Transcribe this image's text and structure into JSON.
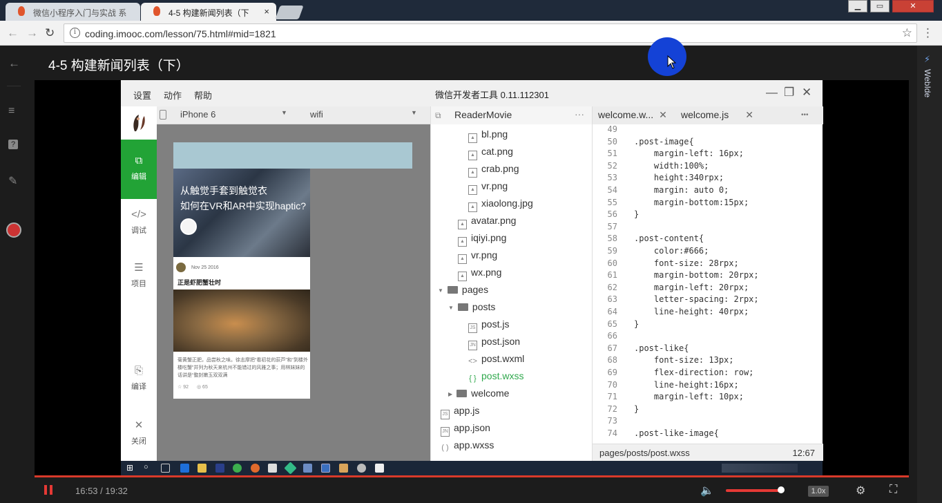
{
  "browser": {
    "tabs": [
      {
        "title": "微信小程序入门与实战 系"
      },
      {
        "title": "4-5 构建新闻列表（下",
        "close": "×"
      }
    ],
    "url": "coding.imooc.com/lesson/75.html#mid=1821",
    "window_controls": [
      "▁",
      "▭",
      "✕"
    ]
  },
  "lesson": {
    "title": "4-5 构建新闻列表（下）"
  },
  "right_panel": {
    "label": "WebIde"
  },
  "ide": {
    "menu": [
      "设置",
      "动作",
      "帮助"
    ],
    "title": "微信开发者工具 0.11.112301",
    "sidebar": [
      {
        "label": "编辑",
        "icon": "code-square-icon",
        "active": true
      },
      {
        "label": "调试",
        "icon": "code-icon"
      },
      {
        "label": "项目",
        "icon": "list-icon"
      },
      {
        "label": "编译",
        "icon": "compile-icon"
      },
      {
        "label": "关闭",
        "icon": "close-icon"
      }
    ],
    "simulator": {
      "device": "iPhone 6",
      "network": "wifi",
      "banner_title": "从触觉手套到触觉衣",
      "banner_subtitle": "如何在VR和AR中实现haptic?",
      "post_date": "Nov 25 2016",
      "post_title": "正是虾肥蟹壮时",
      "post_body": "菊黄蟹正肥，品尝秋之味。徐志摩把“看初花的荻芦”和“到楼外楼吃蟹”并列为秋天来杭州不能错过的风雅之事；用林妹妹的话讲是“螯封嫩玉双双满",
      "post_stars": "92",
      "post_views": "65"
    },
    "tree": {
      "project": "ReaderMovie",
      "items": [
        "bl.png",
        "cat.png",
        "crab.png",
        "vr.png",
        "xiaolong.jpg",
        "avatar.png",
        "iqiyi.png",
        "vr.png",
        "wx.png",
        "pages",
        "posts",
        "post.js",
        "post.json",
        "post.wxml",
        "post.wxss",
        "welcome",
        "app.js",
        "app.json",
        "app.wxss"
      ]
    },
    "editor": {
      "tabs": [
        "welcome.w...",
        "welcome.js"
      ],
      "more": "•••",
      "lines": [
        {
          "n": "49",
          "code": ""
        },
        {
          "n": "50",
          "code": ".post-image{"
        },
        {
          "n": "51",
          "code": "    margin-left: 16px;"
        },
        {
          "n": "52",
          "code": "    width:100%;"
        },
        {
          "n": "53",
          "code": "    height:340rpx;"
        },
        {
          "n": "54",
          "code": "    margin: auto 0;"
        },
        {
          "n": "55",
          "code": "    margin-bottom:15px;"
        },
        {
          "n": "56",
          "code": "}"
        },
        {
          "n": "57",
          "code": ""
        },
        {
          "n": "58",
          "code": ".post-content{"
        },
        {
          "n": "59",
          "code": "    color:#666;"
        },
        {
          "n": "60",
          "code": "    font-size: 28rpx;"
        },
        {
          "n": "61",
          "code": "    margin-bottom: 20rpx;"
        },
        {
          "n": "62",
          "code": "    margin-left: 20rpx;"
        },
        {
          "n": "63",
          "code": "    letter-spacing: 2rpx;"
        },
        {
          "n": "64",
          "code": "    line-height: 40rpx;"
        },
        {
          "n": "65",
          "code": "}"
        },
        {
          "n": "66",
          "code": ""
        },
        {
          "n": "67",
          "code": ".post-like{"
        },
        {
          "n": "68",
          "code": "    font-size: 13px;"
        },
        {
          "n": "69",
          "code": "    flex-direction: row;"
        },
        {
          "n": "70",
          "code": "    line-height:16px;"
        },
        {
          "n": "71",
          "code": "    margin-left: 10px;"
        },
        {
          "n": "72",
          "code": "}"
        },
        {
          "n": "73",
          "code": ""
        },
        {
          "n": "74",
          "code": ".post-like-image{"
        }
      ],
      "status_path": "pages/posts/post.wxss",
      "status_pos": "12:67"
    }
  },
  "player": {
    "time": "16:53 / 19:32",
    "speed": "1.0x",
    "volume": 0.95
  }
}
